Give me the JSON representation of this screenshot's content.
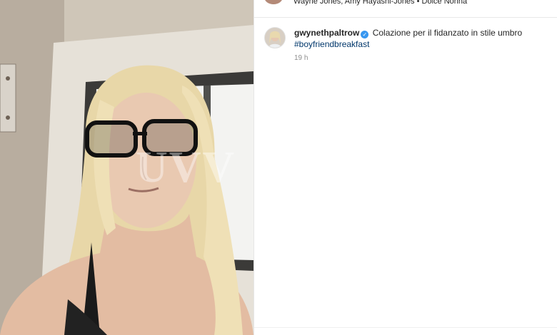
{
  "media": {
    "watermark": "UVV"
  },
  "header": {
    "liked_by": "Wayne Jones, Amy Hayashi-Jones • Dolce Nonna"
  },
  "post": {
    "username": "gwynethpaltrow",
    "verified_icon": "verified-badge-icon",
    "caption": "Colazione per il fidanzato in stile umbro",
    "hashtag": "#boyfriendbreakfast",
    "timestamp": "19 h"
  },
  "colors": {
    "link": "#00376b",
    "verified": "#3897f0",
    "muted": "#8e8e8e"
  }
}
